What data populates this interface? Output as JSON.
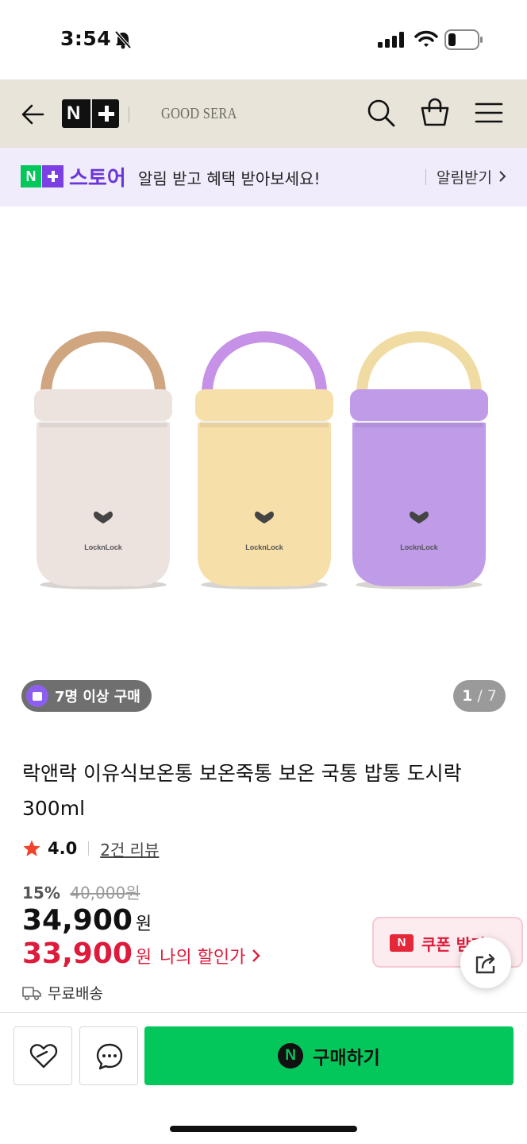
{
  "status_bar": {
    "time": "3:54"
  },
  "header": {
    "brand_name": "GOOD SERA",
    "logo_letter": "N"
  },
  "promo": {
    "logo_letter": "N",
    "store_label": "스토어",
    "message": "알림 받고 혜택 받아보세요!",
    "cta": "알림받기"
  },
  "gallery": {
    "group_badge": "7명 이상 구매",
    "current_page": "1",
    "total_pages": "/ 7",
    "products": [
      {
        "brand": "LocknLock",
        "body_color": "#ece3df",
        "handle_color": "#cfa67f"
      },
      {
        "brand": "LocknLock",
        "body_color": "#f7dfa9",
        "handle_color": "#c692e8"
      },
      {
        "brand": "LocknLock",
        "body_color": "#bf9be8",
        "handle_color": "#f0dca2"
      }
    ]
  },
  "product": {
    "title": "락앤락 이유식보온통 보온죽통 보온 국통 밥통 도시락 300ml",
    "rating": "4.0",
    "reviews": "2건 리뷰",
    "discount_rate": "15%",
    "original_price": "40,000원",
    "price": "34,900",
    "currency": "원",
    "my_price": "33,900",
    "my_price_label": "나의 할인가",
    "coupon_icon": "N",
    "coupon_label": "쿠폰 받기",
    "shipping": "무료배송"
  },
  "bottom_bar": {
    "pay_icon": "N",
    "buy_label": "구매하기"
  },
  "icons": [
    "bell-off-icon",
    "signal-icon",
    "wifi-icon",
    "battery-icon",
    "back-arrow-icon",
    "search-icon",
    "cart-icon",
    "menu-icon",
    "chevron-right-icon",
    "star-icon",
    "share-icon",
    "truck-icon",
    "heart-icon",
    "chat-icon"
  ],
  "colors": {
    "naver_green": "#03c75a",
    "store_purple": "#6a36d9",
    "sale_red": "#dd1c3c",
    "header_bg": "#e9e4da"
  }
}
